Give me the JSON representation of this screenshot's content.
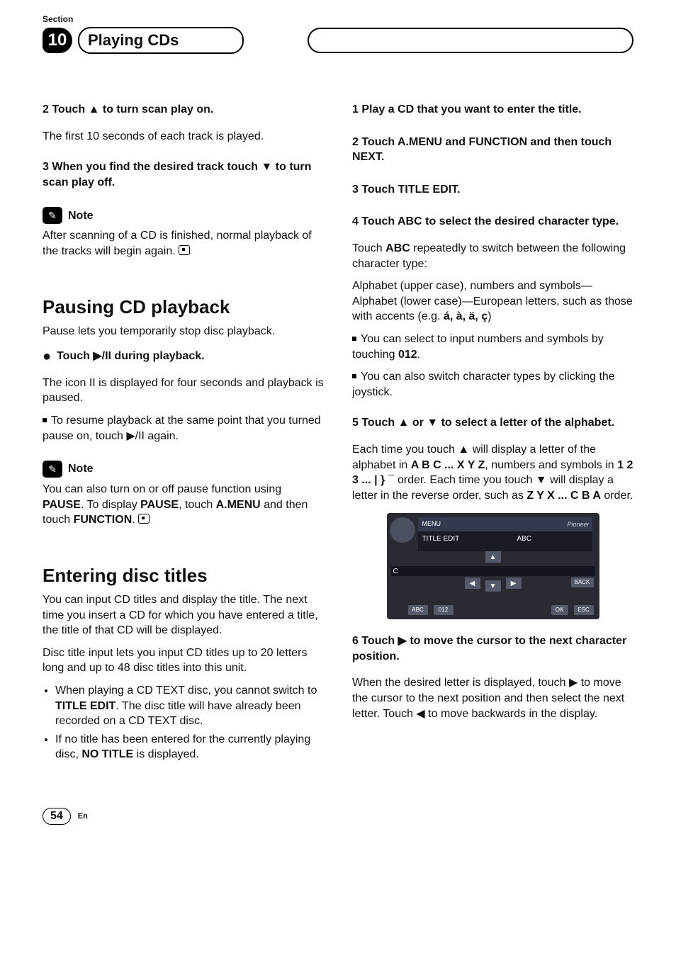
{
  "header": {
    "section_label": "Section",
    "section_number": "10",
    "chapter_title": "Playing CDs"
  },
  "left_col": {
    "step2_heading": "2   Touch ▲ to turn scan play on.",
    "step2_body": "The first 10 seconds of each track is played.",
    "step3_heading": "3   When you find the desired track touch ▼ to turn scan play off.",
    "note1_label": "Note",
    "note1_body": "After scanning of a CD is finished, normal playback of the tracks will begin again.",
    "h_pausing": "Pausing CD playback",
    "pausing_body": "Pause lets you temporarily stop disc playback.",
    "pausing_step_heading": "Touch ▶/II during playback.",
    "pausing_step_body": "The icon II is displayed for four seconds and playback is paused.",
    "pausing_resume": "To resume playback at the same point that you turned pause on, touch ▶/II again.",
    "note2_label": "Note",
    "note2_body_1": "You can also turn on or off pause function using ",
    "note2_pause": "PAUSE",
    "note2_body_2": ". To display ",
    "note2_body_3": ", touch ",
    "note2_amenu": "A.MENU",
    "note2_body_4": " and then touch ",
    "note2_function": "FUNCTION",
    "note2_body_5": ".",
    "h_titles": "Entering disc titles",
    "titles_body": "You can input CD titles and display the title. The next time you insert a CD for which you have entered a title, the title of that CD will be displayed.",
    "titles_body2": "Disc title input lets you input CD titles up to 20 letters long and up to 48 disc titles into this unit.",
    "titles_bullet1_a": "When playing a CD TEXT disc, you cannot switch to ",
    "titles_bullet1_bold": "TITLE EDIT",
    "titles_bullet1_b": ". The disc title will have already been recorded on a CD TEXT disc.",
    "titles_bullet2_a": "If no title has been entered for the currently playing disc, ",
    "titles_bullet2_bold": "NO TITLE",
    "titles_bullet2_b": " is displayed."
  },
  "right_col": {
    "step1_heading": "1   Play a CD that you want to enter the title.",
    "step2_heading": "2   Touch A.MENU and FUNCTION and then touch NEXT.",
    "step3_heading": "3   Touch TITLE EDIT.",
    "step4_heading": "4   Touch ABC to select the desired character type.",
    "step4_body_a": "Touch ",
    "step4_abc": "ABC",
    "step4_body_b": " repeatedly to switch between the following character type:",
    "step4_body2": "Alphabet (upper case), numbers and symbols—Alphabet (lower case)—European letters, such as those with accents (e.g. ",
    "step4_accents": "á, à, ä, ç",
    "step4_body2_close": ")",
    "step4_sq1_a": "You can select to input numbers and symbols by touching ",
    "step4_sq1_bold": "012",
    "step4_sq1_b": ".",
    "step4_sq2": "You can also switch character types by clicking the joystick.",
    "step5_heading": "5   Touch ▲ or ▼ to select a letter of the alphabet.",
    "step5_body_a": "Each time you touch ▲ will display a letter of the alphabet in ",
    "step5_bold1": "A B C ... X Y Z",
    "step5_body_b": ", numbers and symbols in ",
    "step5_bold2": "1 2 3 ... | } ¯",
    "step5_body_c": " order. Each time you touch ▼ will display a letter in the reverse order, such as ",
    "step5_bold3": "Z Y X ... C B A",
    "step5_body_d": " order.",
    "device": {
      "menu": "MENU",
      "title_edit": "TITLE EDIT",
      "abc_label": "ABC",
      "back": "BACK",
      "ok": "OK",
      "esc": "ESC",
      "abc_btn": "ABC",
      "n012": "012",
      "letter": "C",
      "brand": "Pioneer"
    },
    "step6_heading": "6   Touch ▶ to move the cursor to the next character position.",
    "step6_body": "When the desired letter is displayed, touch ▶ to move the cursor to the next position and then select the next letter. Touch ◀ to move backwards in the display."
  },
  "footer": {
    "page_num": "54",
    "lang": "En"
  }
}
